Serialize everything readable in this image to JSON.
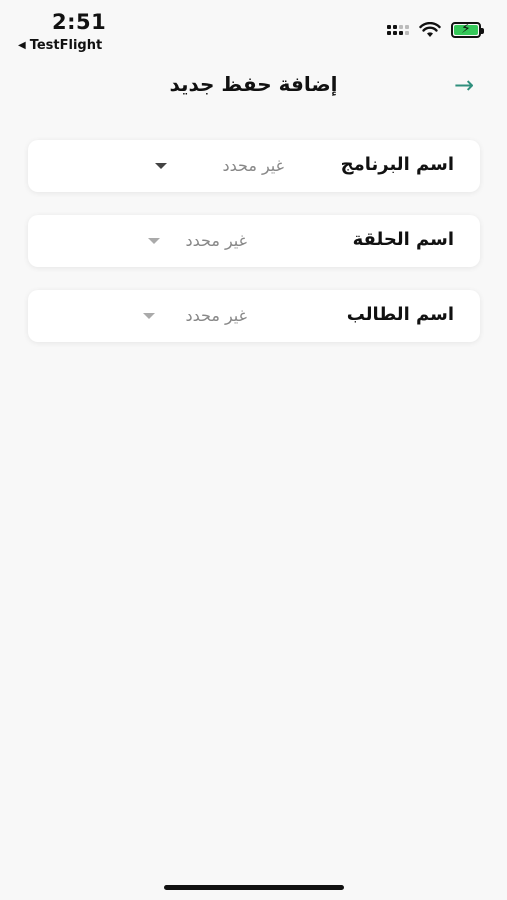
{
  "status_bar": {
    "time": "2:51",
    "back_app": "TestFlight",
    "back_icon": "back-triangle-icon"
  },
  "header": {
    "title": "إضافة حفظ جديد",
    "back_icon": "arrow-right-icon",
    "back_glyph": "→",
    "accent_color": "#2f8f7d"
  },
  "form": {
    "fields": [
      {
        "label": "اسم البرنامج",
        "value": "غير محدد"
      },
      {
        "label": "اسم الحلقة",
        "value": "غير محدد"
      },
      {
        "label": "اسم الطالب",
        "value": "غير محدد"
      }
    ]
  }
}
